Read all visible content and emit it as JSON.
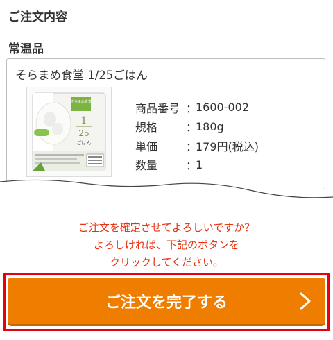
{
  "page": {
    "section_title": "ご注文内容"
  },
  "category": {
    "label": "常温品"
  },
  "product": {
    "name": "そらまめ食堂 1/25ごはん",
    "image_icon": "rice-pack-image",
    "specs": [
      {
        "label": "商品番号",
        "value": "1600-002"
      },
      {
        "label": "規格",
        "value": "180g"
      },
      {
        "label": "単価",
        "value": "179円(税込)"
      },
      {
        "label": "数量",
        "value": "1"
      }
    ],
    "image_text": {
      "brand": "そらまめ食堂",
      "ratio_top": "1",
      "ratio_bottom": "25",
      "name": "ごはん"
    }
  },
  "confirm": {
    "lines": [
      "ご注文を確定させてよろしいですか？",
      "よろしければ、下記のボタンを",
      "クリックしてください。"
    ],
    "color": "#e63312"
  },
  "submit": {
    "label": "ご注文を完了する",
    "icon": "chevron-right-icon",
    "color": "#ee7d00"
  }
}
